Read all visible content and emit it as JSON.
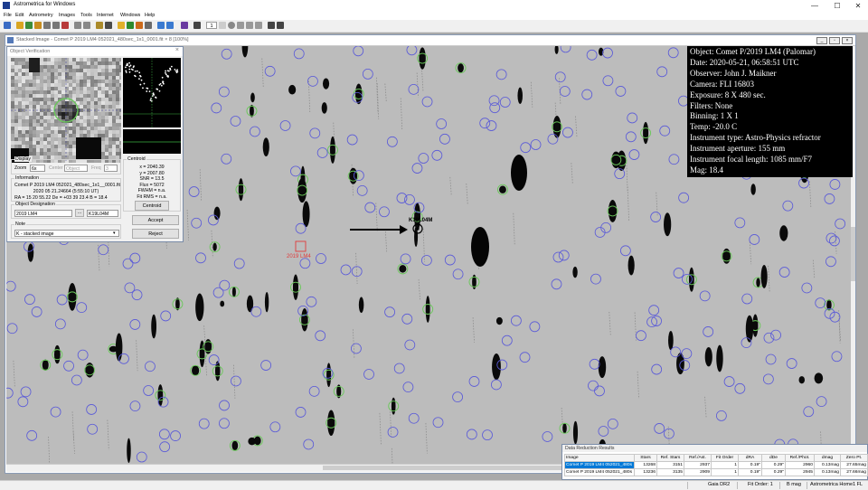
{
  "window": {
    "title": "Astrometrica for Windows"
  },
  "window_controls": {
    "minimize": "—",
    "maximize": "☐",
    "close": "✕"
  },
  "menu": [
    "File",
    "Edit",
    "Astrometry",
    "Images",
    "Tools",
    "Internet",
    "Windows",
    "Help"
  ],
  "toolbar": {
    "frame_value": "1"
  },
  "image_window": {
    "title": "Stacked Image - Comet P 2019 LM4 052021_480sec_1x1_0001.fit × 8 [100%]"
  },
  "overlay": {
    "lines": [
      "Object: Comet P/2019 LM4 (Palomar)",
      "Date: 2020-05-21, 06:58:51 UTC",
      "Observer: John J. Maikner",
      "Camera: FLI 16803",
      "Exposure: 8 X 480 sec.",
      "Filters: None",
      "Binning: 1 X 1",
      "Temp: -20.0 C",
      "Instrument type: Astro-Physics refractor",
      "Instrument aperture: 155 mm",
      "Instrument focal length: 1085 mm/F7",
      "Mag: 18.4"
    ],
    "target_label": "K19L04M",
    "red_marker_label": "2019 LM4"
  },
  "object_verification": {
    "title": "Object Verification",
    "display": {
      "group": "Display",
      "zoom_label": "Zoom",
      "zoom_value": "6x",
      "center_label": "Center",
      "center_value": "Object",
      "freq_label": "Freq",
      "freq_value": "3"
    },
    "centroid": {
      "group": "Centroid",
      "lines": [
        "x = 2040.39",
        "y = 2007.80",
        "SNR = 13.5",
        "Flux = 5072",
        "FWHM = n.a.",
        "Fit RMS = n.a."
      ],
      "button": "Centroid"
    },
    "information": {
      "group": "Information",
      "lines": [
        "Comet P 2019 LM4 052021_480sec_1x1__0001.fit",
        "2020 05 21.24664 (5:55:10 UT)",
        "RA = 15 20 55.22   De = +03 39 23.4   B = 18.4"
      ]
    },
    "designation": {
      "group": "Object Designation",
      "value": "2019 LM4",
      "button": "...",
      "code": "K19L04M"
    },
    "note": {
      "group": "Note",
      "value": "K - stacked image"
    },
    "accept": "Accept",
    "reject": "Reject"
  },
  "data_reduction": {
    "title": "Data Reduction Results",
    "columns": [
      "Image",
      "Stars",
      "Ref. Stars",
      "Ref./Ast.",
      "Fit Order",
      "dRA",
      "dDe",
      "Ref./Phot.",
      "dmag",
      "Zero Pt."
    ],
    "rows": [
      [
        "Comet P 2019 LM4 052021_480s",
        "13268",
        "3151",
        "2937",
        "1",
        "0.19\"",
        "0.29\"",
        "2960",
        "0.13mag",
        "27.65mag"
      ],
      [
        "Comet P 2019 LM4 052021_480s",
        "13236",
        "3135",
        "2909",
        "1",
        "0.19\"",
        "0.29\"",
        "2945",
        "0.13mag",
        "27.66mag"
      ]
    ]
  },
  "statusbar": {
    "catalog": "Gaia DR2",
    "fit": "Fit Order: 1",
    "band": "B mag",
    "site": "Astrometrica Home1 FL"
  },
  "colors": {
    "accent": "#0078d7",
    "match_circle": "#6ac85a",
    "catalog_circle": "#5a5ad8",
    "marker": "#e03a3a"
  }
}
